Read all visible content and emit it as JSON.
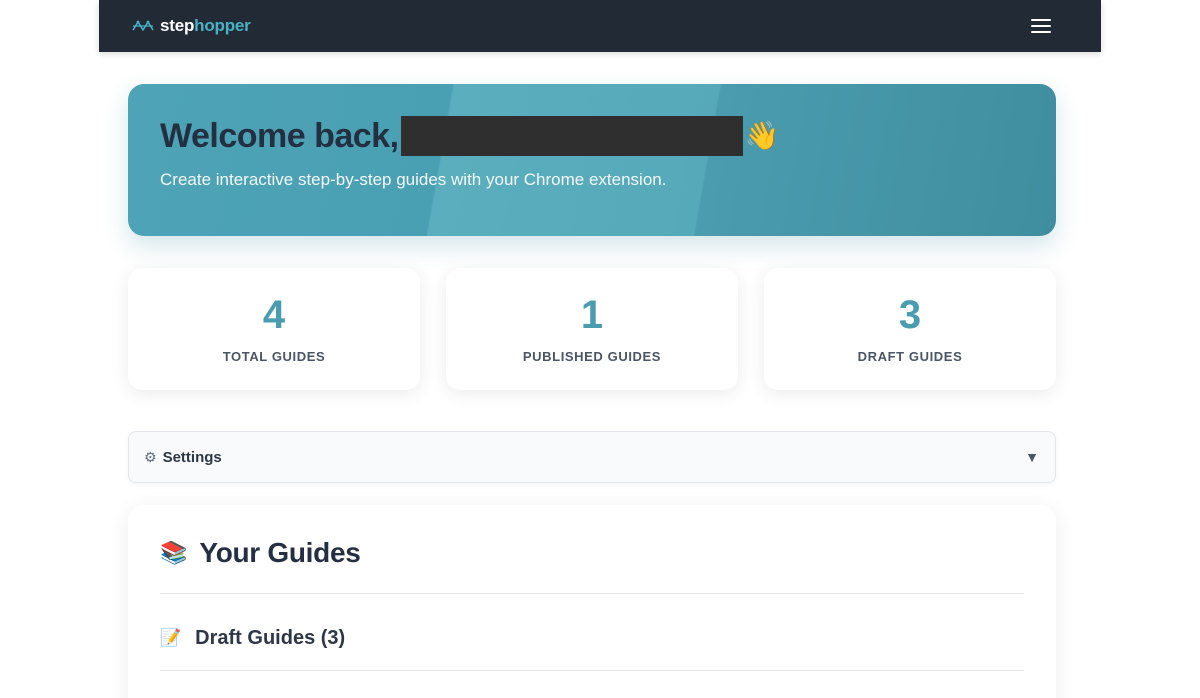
{
  "brand": {
    "name_part1": "step",
    "name_part2": "hopper"
  },
  "hero": {
    "title": "Welcome back,",
    "emoji": "👋",
    "subtitle": "Create interactive step-by-step guides with your Chrome extension."
  },
  "stats": [
    {
      "value": "4",
      "label": "TOTAL GUIDES"
    },
    {
      "value": "1",
      "label": "PUBLISHED GUIDES"
    },
    {
      "value": "3",
      "label": "DRAFT GUIDES"
    }
  ],
  "settings": {
    "icon": "⚙",
    "label": "Settings",
    "caret": "▼"
  },
  "guides": {
    "icon": "📚",
    "title": "Your Guides",
    "draft_section": {
      "icon": "📝",
      "title": "Draft Guides (3)"
    }
  },
  "colors": {
    "topbar": "#222a36",
    "accent": "#4a9cb0",
    "brand_accent": "#4ab0c4"
  }
}
